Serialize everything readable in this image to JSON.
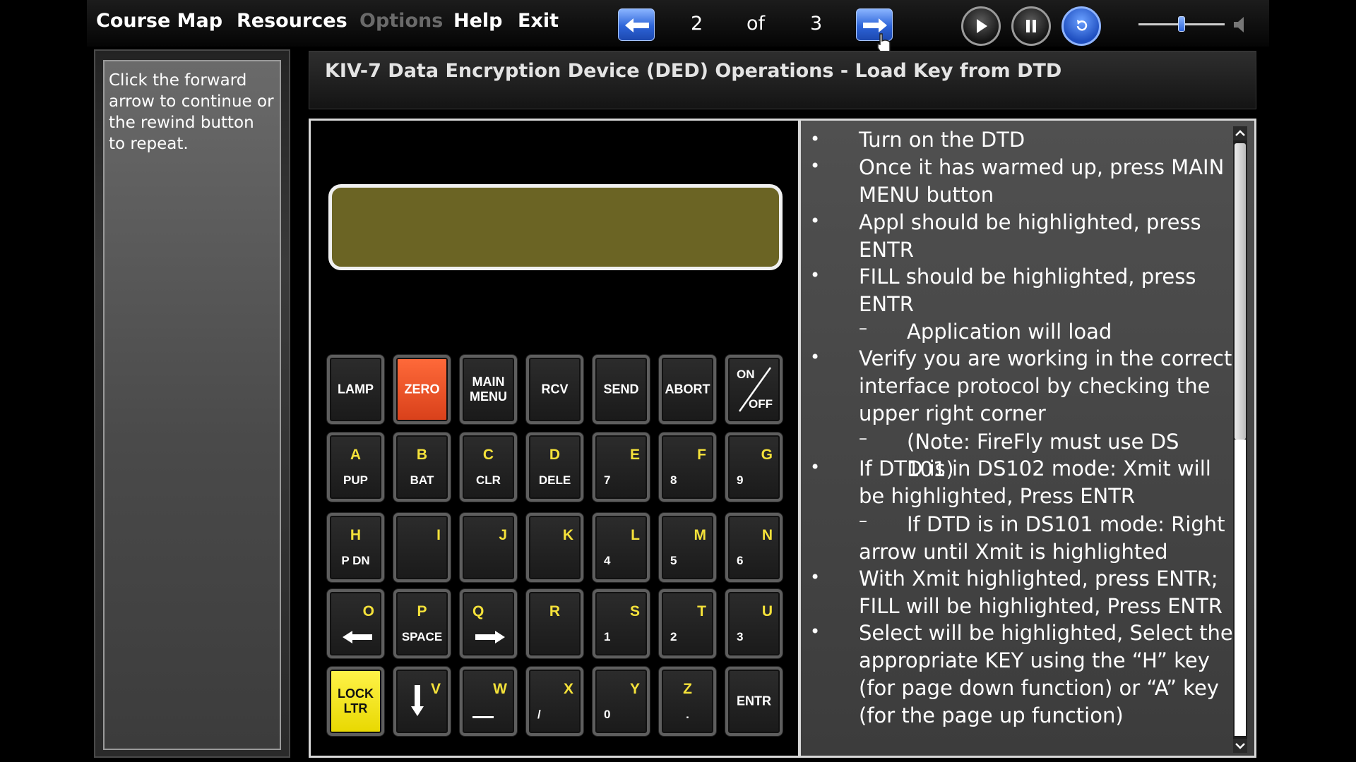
{
  "menu": {
    "course_map": "Course Map",
    "resources": "Resources",
    "options": "Options",
    "help": "Help",
    "exit": "Exit"
  },
  "pager": {
    "current": "2",
    "of": "of",
    "total": "3"
  },
  "volume": {
    "level_percent": 50
  },
  "colors": {
    "accent": "#2d64d8",
    "lcd": "#6b6424",
    "zero_key": "#e04a20",
    "lock_key": "#f2e420"
  },
  "sidebar": {
    "instruction": "Click the forward arrow to continue or the rewind button to repeat."
  },
  "page": {
    "title": "KIV-7 Data Encryption Device (DED) Operations - Load Key from DTD"
  },
  "keypad": {
    "row1": [
      "LAMP",
      "ZERO",
      "MAIN\nMENU",
      "RCV",
      "SEND",
      "ABORT"
    ],
    "on_off": {
      "on": "ON",
      "off": "OFF"
    },
    "row2": [
      {
        "letter": "A",
        "sub": "PUP"
      },
      {
        "letter": "B",
        "sub": "BAT"
      },
      {
        "letter": "C",
        "sub": "CLR"
      },
      {
        "letter": "D",
        "sub": "DELE"
      },
      {
        "letter": "E",
        "sub": "7"
      },
      {
        "letter": "F",
        "sub": "8"
      },
      {
        "letter": "G",
        "sub": "9"
      }
    ],
    "row3": [
      {
        "letter": "H",
        "sub": "P DN"
      },
      {
        "letter": "I",
        "sub": ""
      },
      {
        "letter": "J",
        "sub": ""
      },
      {
        "letter": "K",
        "sub": ""
      },
      {
        "letter": "L",
        "sub": "4"
      },
      {
        "letter": "M",
        "sub": "5"
      },
      {
        "letter": "N",
        "sub": "6"
      }
    ],
    "row4": [
      {
        "letter": "O",
        "sub": ""
      },
      {
        "letter": "P",
        "sub": "SPACE"
      },
      {
        "letter": "Q",
        "sub": ""
      },
      {
        "letter": "R",
        "sub": ""
      },
      {
        "letter": "S",
        "sub": "1"
      },
      {
        "letter": "T",
        "sub": "2"
      },
      {
        "letter": "U",
        "sub": "3"
      }
    ],
    "row5": [
      {
        "letter": "",
        "sub": "LOCK\nLTR"
      },
      {
        "letter": "V",
        "sub": ""
      },
      {
        "letter": "W",
        "sub": ""
      },
      {
        "letter": "X",
        "sub": "/"
      },
      {
        "letter": "Y",
        "sub": "0"
      },
      {
        "letter": "Z",
        "sub": "."
      },
      {
        "letter": "",
        "sub": "ENTR"
      }
    ]
  },
  "instructions": [
    {
      "level": 1,
      "text": "Turn on the DTD"
    },
    {
      "level": 1,
      "text": "Once it has warmed up, press MAIN MENU button"
    },
    {
      "level": 1,
      "text": "Appl should be highlighted, press ENTR"
    },
    {
      "level": 1,
      "text": "FILL should be highlighted, press ENTR"
    },
    {
      "level": 2,
      "text": "Application will load"
    },
    {
      "level": 1,
      "text": "Verify you are working in the correct interface protocol by checking the upper right corner"
    },
    {
      "level": 2,
      "text": "(Note: FireFly must use DS 101)"
    },
    {
      "level": 1,
      "text": "If DTD is in DS102 mode: Xmit will be highlighted, Press ENTR"
    },
    {
      "level": 2,
      "text": "If DTD is in DS101 mode: Right arrow until Xmit is highlighted"
    },
    {
      "level": 1,
      "text": "With Xmit highlighted, press ENTR; FILL will be highlighted, Press ENTR"
    },
    {
      "level": 1,
      "text": "Select will be highlighted, Select the appropriate KEY using the “H” key (for page down function) or “A” key (for the page up function)"
    }
  ]
}
